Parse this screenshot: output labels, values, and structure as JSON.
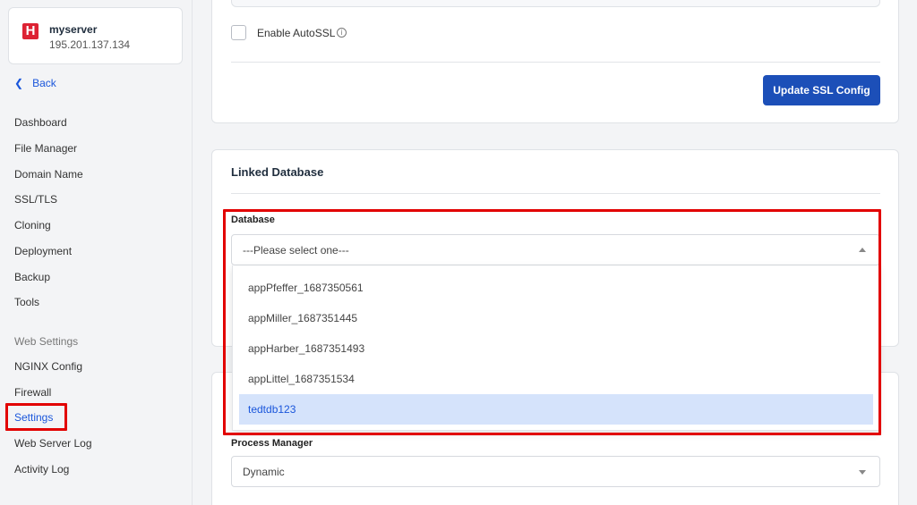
{
  "sidebar": {
    "server": {
      "logo_letter": "H",
      "name": "myserver",
      "ip": "195.201.137.134"
    },
    "back_label": "Back",
    "items": [
      {
        "label": "Dashboard"
      },
      {
        "label": "File Manager"
      },
      {
        "label": "Domain Name"
      },
      {
        "label": "SSL/TLS"
      },
      {
        "label": "Cloning"
      },
      {
        "label": "Deployment"
      },
      {
        "label": "Backup"
      },
      {
        "label": "Tools"
      }
    ],
    "web_settings_heading": "Web Settings",
    "web_items": [
      {
        "label": "NGINX Config"
      },
      {
        "label": "Firewall"
      },
      {
        "label": "Settings",
        "active": true
      },
      {
        "label": "Web Server Log"
      },
      {
        "label": "Activity Log"
      }
    ]
  },
  "ssl": {
    "autossl_label": "Enable AutoSSL",
    "info_glyph": "i",
    "update_button": "Update SSL Config"
  },
  "linked_database": {
    "title": "Linked Database",
    "database_label": "Database",
    "select_value": "---Please select one---",
    "options": [
      {
        "label": "appPfeffer_1687350561"
      },
      {
        "label": "appMiller_1687351445"
      },
      {
        "label": "appHarber_1687351493"
      },
      {
        "label": "appLittel_1687351534"
      },
      {
        "label": "tedtdb123",
        "highlighted": true
      }
    ]
  },
  "php": {
    "process_manager_label": "Process Manager",
    "process_manager_value": "Dynamic"
  },
  "colors": {
    "accent": "#1c4fb8",
    "highlight_box": "#e20000",
    "selected_option_bg": "#d5e3fb",
    "logo": "#dd2233"
  }
}
